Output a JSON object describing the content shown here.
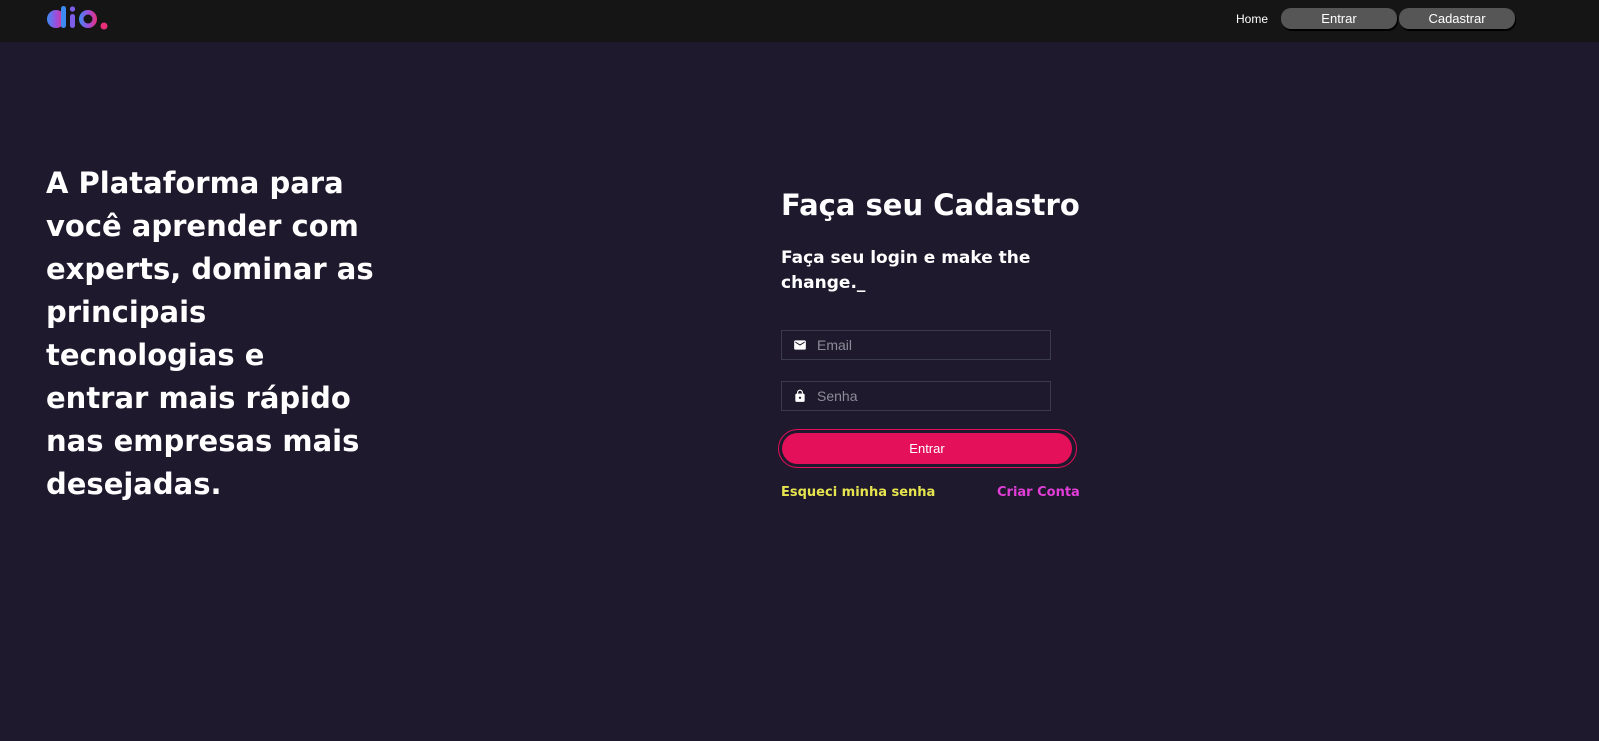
{
  "header": {
    "logo_icon": "dio-logo",
    "nav_home": "Home",
    "login_button": "Entrar",
    "signup_button": "Cadastrar"
  },
  "hero": {
    "text": "A Plataforma para você aprender com experts, dominar as principais tecnologias e entrar mais rápido nas empresas mais desejadas."
  },
  "form": {
    "title": "Faça seu Cadastro",
    "subtitle": "Faça seu login e make the change._",
    "email_icon": "mail-icon",
    "email_placeholder": "Email",
    "password_icon": "lock-icon",
    "password_placeholder": "Senha",
    "submit_label": "Entrar",
    "forgot_password": "Esqueci minha senha",
    "create_account": "Criar Conta"
  },
  "colors": {
    "background": "#1e192c",
    "topbar": "#151515",
    "primary_button": "#e41059",
    "forgot_link": "#e5e44f",
    "create_link": "#e23dd8"
  }
}
